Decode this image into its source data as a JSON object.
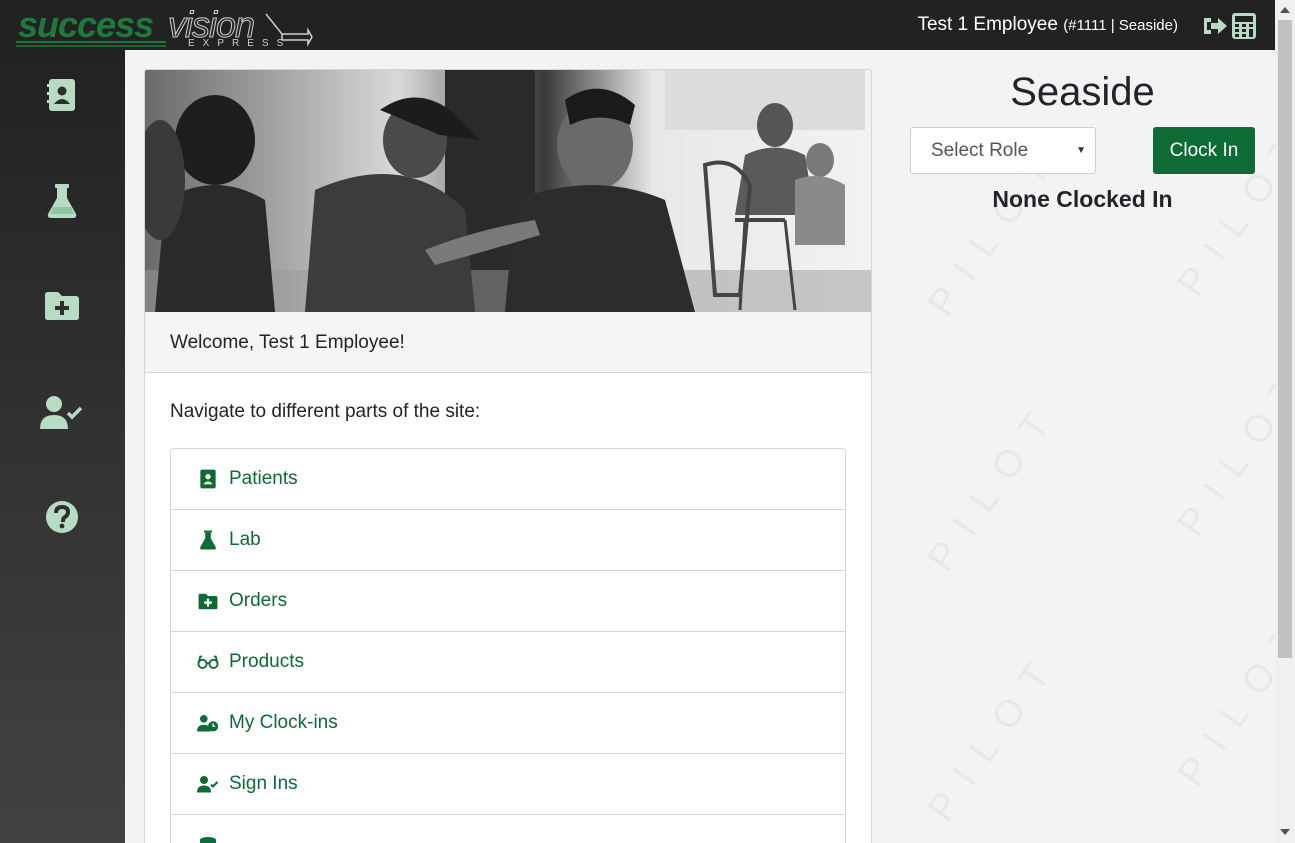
{
  "brand": {
    "logo_word_1": "success",
    "logo_word_2": "vision",
    "logo_tagline": "EXPRESS",
    "primary_color": "#0e6b36"
  },
  "header": {
    "user_name": "Test 1 Employee",
    "user_meta": "(#1111 | Seaside)",
    "icons": [
      "sign-out-icon",
      "calculator-icon"
    ]
  },
  "sidebar": {
    "items": [
      {
        "icon": "address-book-icon"
      },
      {
        "icon": "flask-icon"
      },
      {
        "icon": "folder-plus-icon"
      },
      {
        "icon": "user-check-icon"
      },
      {
        "icon": "question-circle-icon"
      }
    ]
  },
  "main": {
    "welcome": "Welcome, Test 1 Employee!",
    "intro": "Navigate to different parts of the site:",
    "nav_items": [
      {
        "label": "Patients",
        "icon": "address-book-icon"
      },
      {
        "label": "Lab",
        "icon": "flask-icon"
      },
      {
        "label": "Orders",
        "icon": "folder-plus-icon"
      },
      {
        "label": "Products",
        "icon": "glasses-icon"
      },
      {
        "label": "My Clock-ins",
        "icon": "user-clock-icon"
      },
      {
        "label": "Sign Ins",
        "icon": "user-check-icon"
      }
    ]
  },
  "clock_panel": {
    "location": "Seaside",
    "role_select_value": "Select Role",
    "clock_in_label": "Clock In",
    "status": "None Clocked In",
    "watermark": "PILOT"
  }
}
